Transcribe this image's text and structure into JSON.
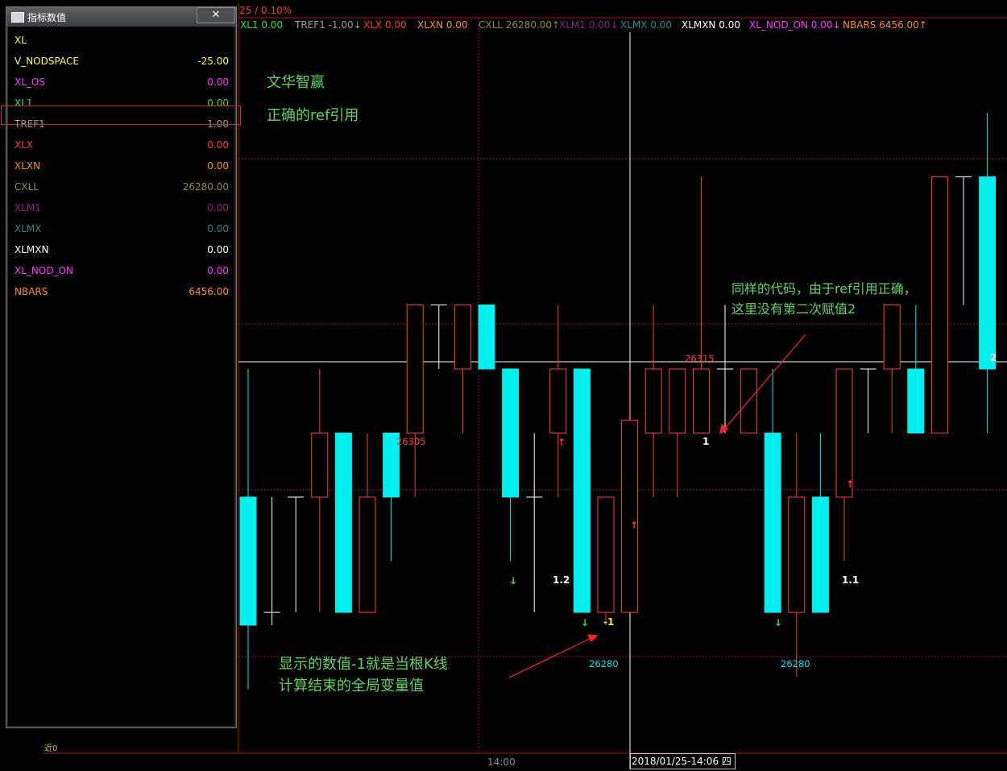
{
  "top_indicator": "25 / 0.10%",
  "header_items": [
    {
      "name": "XL1",
      "value": "0.00",
      "color": "#33dd33",
      "arrow": ""
    },
    {
      "name": "TREF1",
      "value": "-1.00",
      "color": "#9a9a9a",
      "arrow": "↓"
    },
    {
      "name": "XLX",
      "value": "0.00",
      "color": "#ff3333",
      "arrow": ""
    },
    {
      "name": "XLXN",
      "value": "0.00",
      "color": "#ff8c1a",
      "arrow": ""
    },
    {
      "name": "CXLL",
      "value": "26280.00",
      "color": "#8f8a3a",
      "arrow": "↑"
    },
    {
      "name": "XLM1",
      "value": "0.00",
      "color": "#8a1e8a",
      "arrow": "↓"
    },
    {
      "name": "XLMX",
      "value": "0.00",
      "color": "#1e8a8a",
      "arrow": ""
    },
    {
      "name": "XLMXN",
      "value": "0.00",
      "color": "#ffffff",
      "arrow": ""
    },
    {
      "name": "XL_NOD_ON",
      "value": "0.00",
      "color": "#ff33ff",
      "arrow": "↓"
    },
    {
      "name": "NBARS",
      "value": "6456.00",
      "color": "#ff8c1a",
      "arrow": "↑"
    }
  ],
  "panel": {
    "title": "指标数值",
    "close_label": "✕",
    "rows": [
      {
        "name": "XL",
        "value": "",
        "color": "#ffff44"
      },
      {
        "name": "V_NODSPACE",
        "value": "-25.00",
        "color": "#ffff44"
      },
      {
        "name": "XL_OS",
        "value": "0.00",
        "color": "#ff33ff"
      },
      {
        "name": "XL1",
        "value": "0.00",
        "color": "#33dd33"
      },
      {
        "name": "TREF1",
        "value": "-1.00",
        "color": "#9a9a9a"
      },
      {
        "name": "XLX",
        "value": "0.00",
        "color": "#ff3333"
      },
      {
        "name": "XLXN",
        "value": "0.00",
        "color": "#ff8c1a"
      },
      {
        "name": "CXLL",
        "value": "26280.00",
        "color": "#8f8a3a"
      },
      {
        "name": "XLM1",
        "value": "0.00",
        "color": "#8a1e8a"
      },
      {
        "name": "XLMX",
        "value": "0.00",
        "color": "#1e8a8a"
      },
      {
        "name": "XLMXN",
        "value": "0.00",
        "color": "#ffffff"
      },
      {
        "name": "XL_NOD_ON",
        "value": "0.00",
        "color": "#ff33ff"
      },
      {
        "name": "NBARS",
        "value": "6456.00",
        "color": "#ff8c1a"
      }
    ]
  },
  "annotations": {
    "brand": "文华智赢",
    "subtitle": "正确的ref引用",
    "right_note_1": "同样的代码，由于ref引用正确，",
    "right_note_2": "这里没有第二次赋值2",
    "bottom_note_1": "显示的数值-1就是当根K线",
    "bottom_note_2": "计算结束的全局变量值"
  },
  "price_labels": {
    "high_left": "26305",
    "high_mid": "26315",
    "low_left": "26280",
    "low_right": "26280"
  },
  "value_marks": {
    "m12": "1.2",
    "m1": "1",
    "mneg1": "-1",
    "m11": "1.1",
    "m2": "2"
  },
  "time_label": "14:00",
  "date_label": "2018/01/25-14:06 四",
  "tiny_label": "近0",
  "colors": {
    "up": "#ff3b3b",
    "down": "#00f0f0",
    "flat": "#ffffff",
    "grid": "#8b1a1a",
    "annot": "#5fd35f"
  },
  "chart_data": {
    "type": "candlestick",
    "bars": [
      {
        "o": 26280,
        "c": 26290,
        "h": 26300,
        "l": 26275,
        "d": "down"
      },
      {
        "o": 26281,
        "c": 26281,
        "h": 26290,
        "l": 26280,
        "d": "flat"
      },
      {
        "o": 26290,
        "c": 26290,
        "h": 26290,
        "l": 26281,
        "d": "flat"
      },
      {
        "o": 26290,
        "c": 26295,
        "h": 26300,
        "l": 26281,
        "d": "up"
      },
      {
        "o": 26295,
        "c": 26281,
        "h": 26295,
        "l": 26281,
        "d": "down"
      },
      {
        "o": 26281,
        "c": 26290,
        "h": 26295,
        "l": 26281,
        "d": "up"
      },
      {
        "o": 26295,
        "c": 26290,
        "h": 26295,
        "l": 26285,
        "d": "down"
      },
      {
        "o": 26295,
        "c": 26305,
        "h": 26305,
        "l": 26290,
        "d": "up"
      },
      {
        "o": 26305,
        "c": 26305,
        "h": 26305,
        "l": 26300,
        "d": "flat"
      },
      {
        "o": 26300,
        "c": 26305,
        "h": 26305,
        "l": 26295,
        "d": "up"
      },
      {
        "o": 26305,
        "c": 26300,
        "h": 26305,
        "l": 26300,
        "d": "down"
      },
      {
        "o": 26300,
        "c": 26290,
        "h": 26300,
        "l": 26285,
        "d": "down"
      },
      {
        "o": 26290,
        "c": 26290,
        "h": 26295,
        "l": 26281,
        "d": "flat"
      },
      {
        "o": 26295,
        "c": 26300,
        "h": 26305,
        "l": 26290,
        "d": "up"
      },
      {
        "o": 26300,
        "c": 26281,
        "h": 26300,
        "l": 26281,
        "d": "down"
      },
      {
        "o": 26281,
        "c": 26290,
        "h": 26290,
        "l": 26280,
        "d": "up"
      },
      {
        "o": 26281,
        "c": 26296,
        "h": 26300,
        "l": 26281,
        "d": "up"
      },
      {
        "o": 26295,
        "c": 26300,
        "h": 26305,
        "l": 26290,
        "d": "up"
      },
      {
        "o": 26295,
        "c": 26300,
        "h": 26300,
        "l": 26290,
        "d": "up"
      },
      {
        "o": 26295,
        "c": 26300,
        "h": 26315,
        "l": 26295,
        "d": "up"
      },
      {
        "o": 26300,
        "c": 26300,
        "h": 26305,
        "l": 26295,
        "d": "flat"
      },
      {
        "o": 26295,
        "c": 26300,
        "h": 26300,
        "l": 26295,
        "d": "up"
      },
      {
        "o": 26295,
        "c": 26281,
        "h": 26300,
        "l": 26281,
        "d": "down"
      },
      {
        "o": 26281,
        "c": 26290,
        "h": 26295,
        "l": 26276,
        "d": "up"
      },
      {
        "o": 26290,
        "c": 26281,
        "h": 26295,
        "l": 26281,
        "d": "down"
      },
      {
        "o": 26290,
        "c": 26300,
        "h": 26300,
        "l": 26285,
        "d": "up"
      },
      {
        "o": 26300,
        "c": 26300,
        "h": 26300,
        "l": 26295,
        "d": "flat"
      },
      {
        "o": 26300,
        "c": 26305,
        "h": 26305,
        "l": 26295,
        "d": "up"
      },
      {
        "o": 26300,
        "c": 26295,
        "h": 26305,
        "l": 26295,
        "d": "down"
      },
      {
        "o": 26295,
        "c": 26315,
        "h": 26315,
        "l": 26295,
        "d": "up"
      },
      {
        "o": 26315,
        "c": 26315,
        "h": 26315,
        "l": 26305,
        "d": "flat"
      },
      {
        "o": 26315,
        "c": 26300,
        "h": 26320,
        "l": 26295,
        "d": "down"
      }
    ],
    "ylim": [
      26270,
      26320
    ]
  }
}
